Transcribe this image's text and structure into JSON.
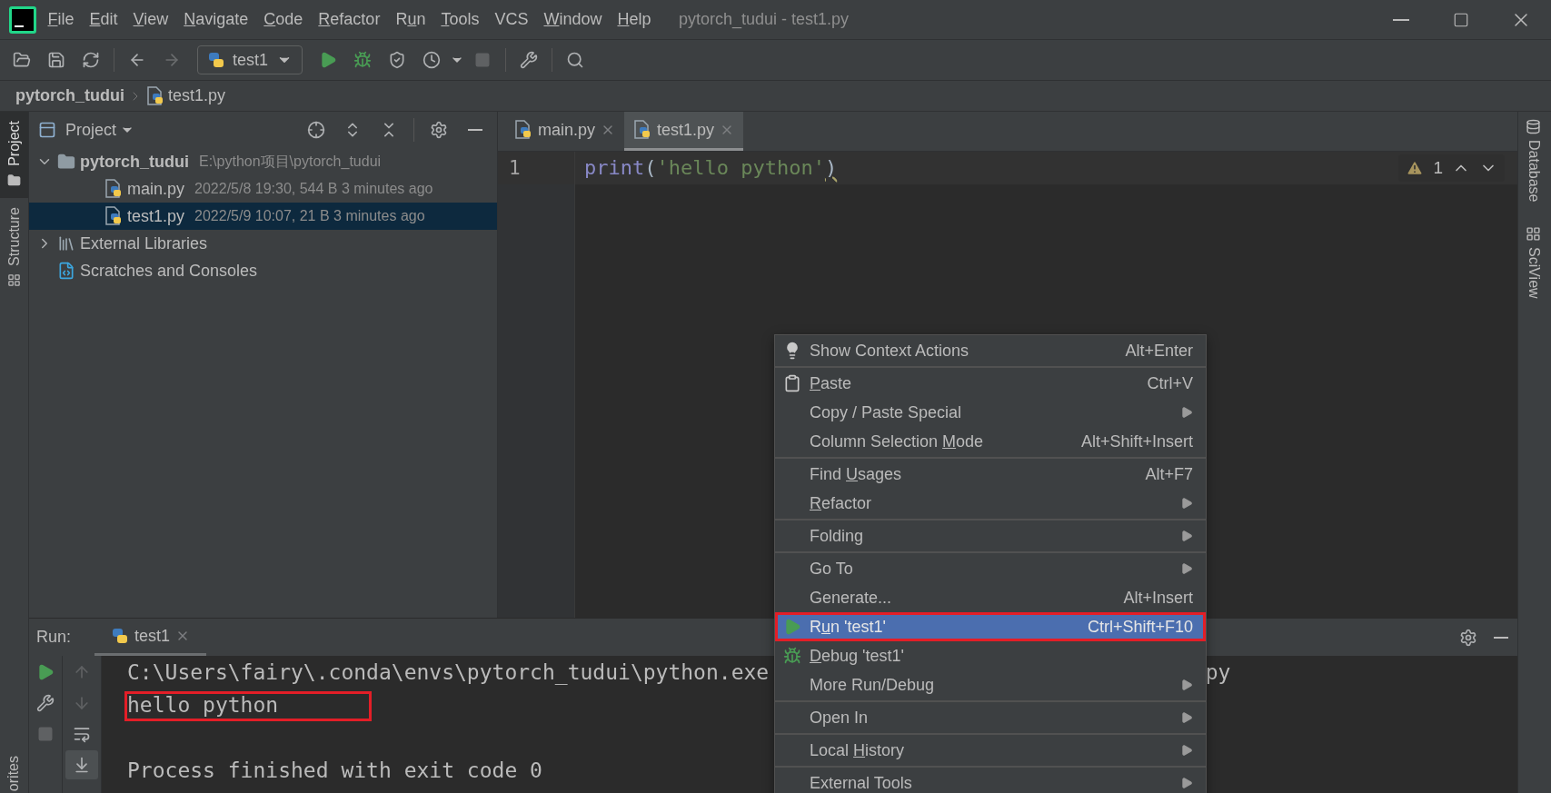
{
  "window": {
    "title": "pytorch_tudui - test1.py"
  },
  "menu_bar": [
    {
      "key": "F",
      "post": "ile"
    },
    {
      "key": "E",
      "post": "dit"
    },
    {
      "key": "V",
      "post": "iew"
    },
    {
      "key": "N",
      "post": "avigate"
    },
    {
      "key": "C",
      "post": "ode"
    },
    {
      "key": "R",
      "post": "efactor"
    },
    {
      "pre": "R",
      "key": "u",
      "post": "n"
    },
    {
      "key": "T",
      "post": "ools"
    },
    {
      "label": "VCS"
    },
    {
      "key": "W",
      "post": "indow"
    },
    {
      "key": "H",
      "post": "elp"
    }
  ],
  "toolbar": {
    "run_config": "test1"
  },
  "breadcrumbs": [
    {
      "label": "pytorch_tudui",
      "kind": "project"
    },
    {
      "label": "test1.py",
      "kind": "file"
    }
  ],
  "left_strip": {
    "tabs": [
      {
        "label": "Project",
        "selected": true
      },
      {
        "label": "Structure",
        "selected": false
      }
    ],
    "bottom_tab": "orites"
  },
  "project_panel": {
    "title": "Project",
    "tree": [
      {
        "name": "pytorch_tudui",
        "detail": "E:\\python项目\\pytorch_tudui",
        "kind": "folder",
        "expanded": true,
        "selected": false,
        "children": [
          {
            "name": "main.py",
            "detail": "2022/5/8 19:30, 544 B 3 minutes ago",
            "kind": "python",
            "selected": false
          },
          {
            "name": "test1.py",
            "detail": "2022/5/9 10:07, 21 B 3 minutes ago",
            "kind": "python",
            "selected": true
          }
        ]
      },
      {
        "name": "External Libraries",
        "kind": "library",
        "expanded": false,
        "selected": false
      },
      {
        "name": "Scratches and Consoles",
        "kind": "scratches",
        "selected": false
      }
    ]
  },
  "editor": {
    "tabs": [
      {
        "label": "main.py",
        "selected": false
      },
      {
        "label": "test1.py",
        "selected": true
      }
    ],
    "lines": [
      {
        "number": "1",
        "tokens": [
          {
            "text": "print",
            "kind": "builtin"
          },
          {
            "text": "(",
            "kind": "punct"
          },
          {
            "text": "'hello python'",
            "kind": "string"
          },
          {
            "text": ")",
            "kind": "punct",
            "squiggle": true
          }
        ]
      }
    ],
    "warnings": "1"
  },
  "right_strip": {
    "tabs": [
      {
        "label": "Database"
      },
      {
        "label": "SciView"
      }
    ]
  },
  "run_panel": {
    "label": "Run:",
    "tabs": [
      {
        "label": "test1",
        "selected": true
      }
    ],
    "console": [
      {
        "kind": "output",
        "text": "C:\\Users\\fairy\\.conda\\envs\\pytorch_tudui\\python.exe",
        "tail": "py",
        "annotated": false
      },
      {
        "kind": "output",
        "text": "hello python",
        "annotated": true
      },
      {
        "kind": "blank"
      },
      {
        "kind": "output",
        "text": "Process finished with exit code 0",
        "annotated": false
      }
    ]
  },
  "context_menu": {
    "groups": [
      {
        "items": [
          {
            "label": "Show Context Actions",
            "shortcut": "Alt+Enter",
            "submenu": false,
            "selected": false,
            "annotated": false
          }
        ]
      },
      {
        "items": [
          {
            "key": "P",
            "post": "aste",
            "shortcut": "Ctrl+V",
            "submenu": false,
            "selected": false,
            "annotated": false
          },
          {
            "label": "Copy / Paste Special",
            "submenu": true,
            "selected": false,
            "annotated": false
          },
          {
            "pre": "Column Selection ",
            "key": "M",
            "post": "ode",
            "shortcut": "Alt+Shift+Insert",
            "submenu": false,
            "selected": false,
            "annotated": false
          }
        ]
      },
      {
        "items": [
          {
            "pre": "Find ",
            "key": "U",
            "post": "sages",
            "shortcut": "Alt+F7",
            "submenu": false,
            "selected": false,
            "annotated": false
          },
          {
            "key": "R",
            "post": "efactor",
            "submenu": true,
            "selected": false,
            "annotated": false
          }
        ]
      },
      {
        "items": [
          {
            "label": "Folding",
            "submenu": true,
            "selected": false,
            "annotated": false
          }
        ]
      },
      {
        "items": [
          {
            "label": "Go To",
            "submenu": true,
            "selected": false,
            "annotated": false
          },
          {
            "label": "Generate...",
            "shortcut": "Alt+Insert",
            "submenu": false,
            "selected": false,
            "annotated": false
          },
          {
            "pre": "R",
            "key": "u",
            "post": "n 'test1'",
            "shortcut": "Ctrl+Shift+F10",
            "submenu": false,
            "selected": true,
            "annotated": true
          },
          {
            "key": "D",
            "post": "ebug 'test1'",
            "submenu": false,
            "selected": false,
            "annotated": false
          },
          {
            "label": "More Run/Debug",
            "submenu": true,
            "selected": false,
            "annotated": false
          }
        ]
      },
      {
        "items": [
          {
            "label": "Open In",
            "submenu": true,
            "selected": false,
            "annotated": false
          }
        ]
      },
      {
        "items": [
          {
            "pre": "Local ",
            "key": "H",
            "post": "istory",
            "submenu": true,
            "selected": false,
            "annotated": false
          }
        ]
      },
      {
        "items": [
          {
            "label": "External Tools",
            "submenu": true,
            "selected": false,
            "annotated": false
          }
        ]
      }
    ]
  }
}
